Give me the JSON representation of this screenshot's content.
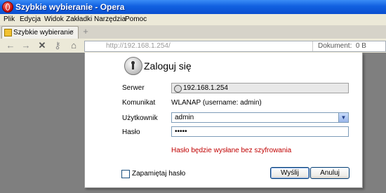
{
  "window": {
    "title": "Szybkie wybieranie - Opera"
  },
  "menu": [
    "Plik",
    "Edycja",
    "Widok",
    "Zakładki",
    "Narzędzia",
    "Pomoc"
  ],
  "tab": {
    "label": "Szybkie wybieranie"
  },
  "nav": {
    "url": "http://192.168.1.254/",
    "doc_label": "Dokument:",
    "doc_value": "0 B"
  },
  "dialog": {
    "title": "Zaloguj się",
    "server_label": "Serwer",
    "server_value": "192.168.1.254",
    "message_label": "Komunikat",
    "message_value": "WLANAP (username: admin)",
    "user_label": "Użytkownik",
    "user_value": "admin",
    "password_label": "Hasło",
    "password_value": "•••••",
    "warning": "Hasło będzie wysłane bez szyfrowania",
    "remember_label": "Zapamiętaj hasło",
    "ok_label": "Wyślij",
    "cancel_label": "Anuluj"
  },
  "colors": {
    "warning": "#c00000",
    "titlebar": "#1160e0"
  }
}
